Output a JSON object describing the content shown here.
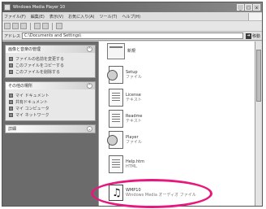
{
  "window": {
    "title": "Windows Media Player 10",
    "controls": [
      "_",
      "□",
      "x"
    ]
  },
  "menubar": {
    "items": [
      "ファイル(F)",
      "編集(E)",
      "表示(V)",
      "お気に入り(A)",
      "ツール(T)",
      "ヘルプ(H)"
    ]
  },
  "address": {
    "label": "アドレス",
    "value": "C:\\Documents and Settings\\",
    "go": "移動"
  },
  "taskpane": {
    "panels": [
      {
        "header": "画像と音楽の管理",
        "tasks": [
          "ファイルの名前を変更する",
          "このファイルをコピーする",
          "このファイルを削除する"
        ]
      },
      {
        "header": "その他の場所",
        "tasks": [
          "マイ ドキュメント",
          "共有ドキュメント",
          "マイ コンピュータ",
          "マイ ネットワーク"
        ]
      },
      {
        "header": "詳細",
        "tasks": []
      }
    ]
  },
  "files": [
    {
      "icon": "folder-icon",
      "name": "新規",
      "sub": ""
    },
    {
      "icon": "media-file-icon",
      "name": "Setup",
      "sub": "ファイル"
    },
    {
      "icon": "document-icon",
      "name": "License",
      "sub": "テキスト"
    },
    {
      "icon": "document-icon",
      "name": "Readme",
      "sub": "テキスト"
    },
    {
      "icon": "media-file-icon",
      "name": "Player",
      "sub": "ファイル"
    },
    {
      "icon": "document-icon",
      "name": "Help.htm",
      "sub": "HTML"
    },
    {
      "icon": "music-file-icon",
      "name": "WMP10",
      "sub": "Windows Media オーディオ ファイル"
    }
  ],
  "colors": {
    "highlight": "#e6187e",
    "taskpane": "#6b6b6b"
  }
}
